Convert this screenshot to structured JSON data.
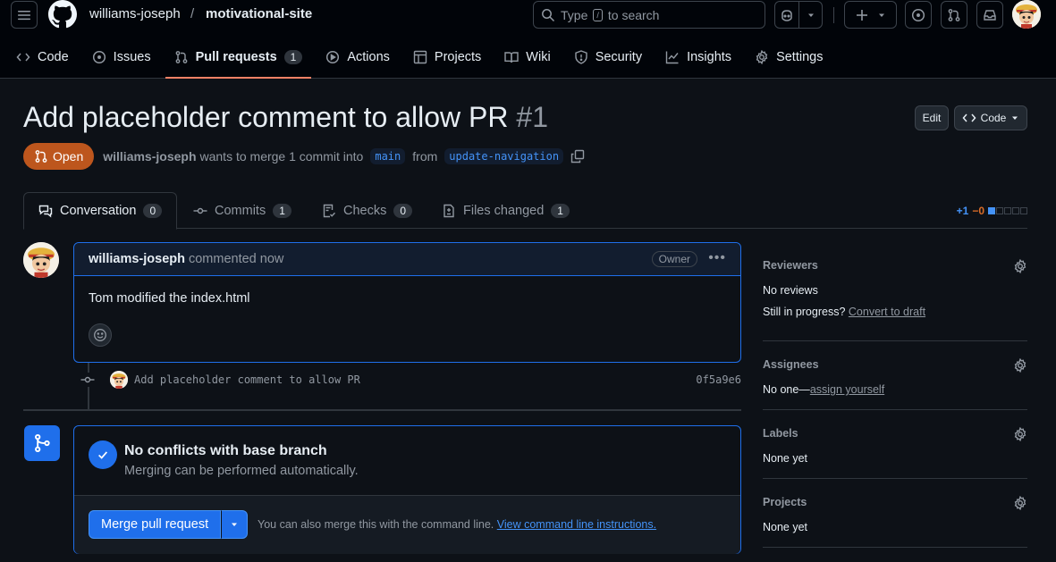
{
  "header": {
    "owner": "williams-joseph",
    "separator": "/",
    "repo": "motivational-site",
    "search_type": "Type",
    "search_key": "/",
    "search_rest": "to search"
  },
  "repo_tabs": [
    {
      "label": "Code",
      "icon": "code-icon"
    },
    {
      "label": "Issues",
      "icon": "issue-icon"
    },
    {
      "label": "Pull requests",
      "icon": "pull-request-icon",
      "count": "1",
      "active": true
    },
    {
      "label": "Actions",
      "icon": "play-icon"
    },
    {
      "label": "Projects",
      "icon": "table-icon"
    },
    {
      "label": "Wiki",
      "icon": "book-icon"
    },
    {
      "label": "Security",
      "icon": "shield-icon"
    },
    {
      "label": "Insights",
      "icon": "graph-icon"
    },
    {
      "label": "Settings",
      "icon": "gear-icon"
    }
  ],
  "pr": {
    "title": "Add placeholder comment to allow PR",
    "number": "#1",
    "edit_label": "Edit",
    "code_label": "Code",
    "state": "Open",
    "author": "williams-joseph",
    "merge_text": "wants to merge 1 commit into",
    "base_branch": "main",
    "from_text": "from",
    "head_branch": "update-navigation"
  },
  "pr_tabs": [
    {
      "label": "Conversation",
      "count": "0"
    },
    {
      "label": "Commits",
      "count": "1"
    },
    {
      "label": "Checks",
      "count": "0"
    },
    {
      "label": "Files changed",
      "count": "1"
    }
  ],
  "diffstat": {
    "additions": "+1",
    "deletions": "−0"
  },
  "comment": {
    "author": "williams-joseph",
    "when": "commented now",
    "role": "Owner",
    "body": "Tom modified the index.html"
  },
  "commit": {
    "message": "Add placeholder comment to allow PR",
    "sha": "0f5a9e6"
  },
  "merge": {
    "title": "No conflicts with base branch",
    "subtitle": "Merging can be performed automatically.",
    "button": "Merge pull request",
    "hint": "You can also merge this with the command line.",
    "hint_link": "View command line instructions."
  },
  "sidebar": {
    "reviewers_h": "Reviewers",
    "reviewers_v": "No reviews",
    "reviewers_v2": "Still in progress?",
    "reviewers_link": "Convert to draft",
    "assignees_h": "Assignees",
    "assignees_v": "No one—",
    "assignees_link": "assign yourself",
    "labels_h": "Labels",
    "labels_v": "None yet",
    "projects_h": "Projects",
    "projects_v": "None yet"
  }
}
